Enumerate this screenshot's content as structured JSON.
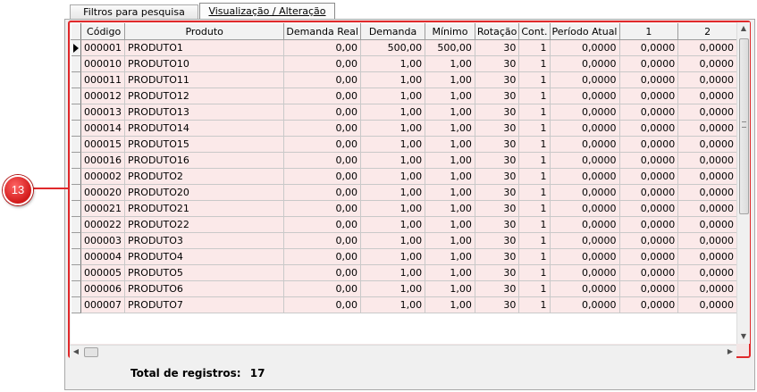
{
  "tabs": [
    {
      "label": "Filtros para pesquisa",
      "active": false
    },
    {
      "label": "Visualização / Alteração",
      "active": true
    }
  ],
  "grid": {
    "columns": [
      "Código",
      "Produto",
      "Demanda Real",
      "Demanda",
      "Mínimo",
      "Rotação",
      "Cont.",
      "Período Atual",
      "1",
      "2"
    ],
    "rows": [
      [
        "000001",
        "PRODUTO1",
        "0,00",
        "500,00",
        "500,00",
        "30",
        "1",
        "0,0000",
        "0,0000",
        "0,0000"
      ],
      [
        "000010",
        "PRODUTO10",
        "0,00",
        "1,00",
        "1,00",
        "30",
        "1",
        "0,0000",
        "0,0000",
        "0,0000"
      ],
      [
        "000011",
        "PRODUTO11",
        "0,00",
        "1,00",
        "1,00",
        "30",
        "1",
        "0,0000",
        "0,0000",
        "0,0000"
      ],
      [
        "000012",
        "PRODUTO12",
        "0,00",
        "1,00",
        "1,00",
        "30",
        "1",
        "0,0000",
        "0,0000",
        "0,0000"
      ],
      [
        "000013",
        "PRODUTO13",
        "0,00",
        "1,00",
        "1,00",
        "30",
        "1",
        "0,0000",
        "0,0000",
        "0,0000"
      ],
      [
        "000014",
        "PRODUTO14",
        "0,00",
        "1,00",
        "1,00",
        "30",
        "1",
        "0,0000",
        "0,0000",
        "0,0000"
      ],
      [
        "000015",
        "PRODUTO15",
        "0,00",
        "1,00",
        "1,00",
        "30",
        "1",
        "0,0000",
        "0,0000",
        "0,0000"
      ],
      [
        "000016",
        "PRODUTO16",
        "0,00",
        "1,00",
        "1,00",
        "30",
        "1",
        "0,0000",
        "0,0000",
        "0,0000"
      ],
      [
        "000002",
        "PRODUTO2",
        "0,00",
        "1,00",
        "1,00",
        "30",
        "1",
        "0,0000",
        "0,0000",
        "0,0000"
      ],
      [
        "000020",
        "PRODUTO20",
        "0,00",
        "1,00",
        "1,00",
        "30",
        "1",
        "0,0000",
        "0,0000",
        "0,0000"
      ],
      [
        "000021",
        "PRODUTO21",
        "0,00",
        "1,00",
        "1,00",
        "30",
        "1",
        "0,0000",
        "0,0000",
        "0,0000"
      ],
      [
        "000022",
        "PRODUTO22",
        "0,00",
        "1,00",
        "1,00",
        "30",
        "1",
        "0,0000",
        "0,0000",
        "0,0000"
      ],
      [
        "000003",
        "PRODUTO3",
        "0,00",
        "1,00",
        "1,00",
        "30",
        "1",
        "0,0000",
        "0,0000",
        "0,0000"
      ],
      [
        "000004",
        "PRODUTO4",
        "0,00",
        "1,00",
        "1,00",
        "30",
        "1",
        "0,0000",
        "0,0000",
        "0,0000"
      ],
      [
        "000005",
        "PRODUTO5",
        "0,00",
        "1,00",
        "1,00",
        "30",
        "1",
        "0,0000",
        "0,0000",
        "0,0000"
      ],
      [
        "000006",
        "PRODUTO6",
        "0,00",
        "1,00",
        "1,00",
        "30",
        "1",
        "0,0000",
        "0,0000",
        "0,0000"
      ],
      [
        "000007",
        "PRODUTO7",
        "0,00",
        "1,00",
        "1,00",
        "30",
        "1",
        "0,0000",
        "0,0000",
        "0,0000"
      ]
    ],
    "selected_row": 0
  },
  "footer": {
    "total_label": "Total de registros:",
    "total_value": "17"
  },
  "callout": {
    "number": "13"
  },
  "colors": {
    "highlight_border": "#e0292b",
    "row_background": "#fbe9e9"
  },
  "icons": {
    "row_indicator": "triangle-right-icon",
    "scroll_up": "arrow-up-icon",
    "scroll_down": "arrow-down-icon",
    "scroll_left": "arrow-left-icon",
    "scroll_right": "arrow-right-icon"
  }
}
